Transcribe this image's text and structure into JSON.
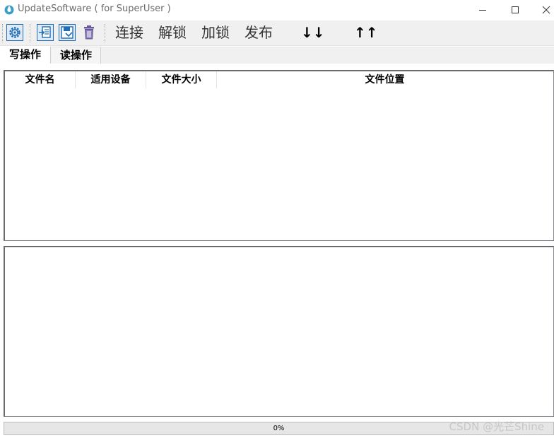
{
  "window": {
    "title": "UpdateSoftware ( for SuperUser )"
  },
  "toolbar": {
    "buttons": [
      {
        "name": "settings",
        "icon": "gear-icon"
      },
      {
        "name": "import",
        "icon": "import-file-icon"
      },
      {
        "name": "save",
        "icon": "save-icon"
      },
      {
        "name": "delete",
        "icon": "trash-icon"
      }
    ],
    "connect_label": "连接",
    "unlock_label": "解锁",
    "lock_label": "加锁",
    "publish_label": "发布",
    "move_down_label": "↓↓",
    "move_up_label": "↑↑"
  },
  "tabs": [
    {
      "label": "写操作",
      "active": true
    },
    {
      "label": "读操作",
      "active": false
    }
  ],
  "file_table": {
    "columns": [
      "文件名",
      "适用设备",
      "文件大小",
      "文件位置"
    ],
    "rows": []
  },
  "log": {
    "text": ""
  },
  "progress": {
    "value": 0,
    "label": "0%"
  },
  "watermark": "CSDN @光芒Shine",
  "colors": {
    "icon_blue": "#1e6fb8",
    "trash_purple": "#6a5a9a",
    "toolbar_bg": "#f0f0f0",
    "progress_fill": "#06b025"
  }
}
